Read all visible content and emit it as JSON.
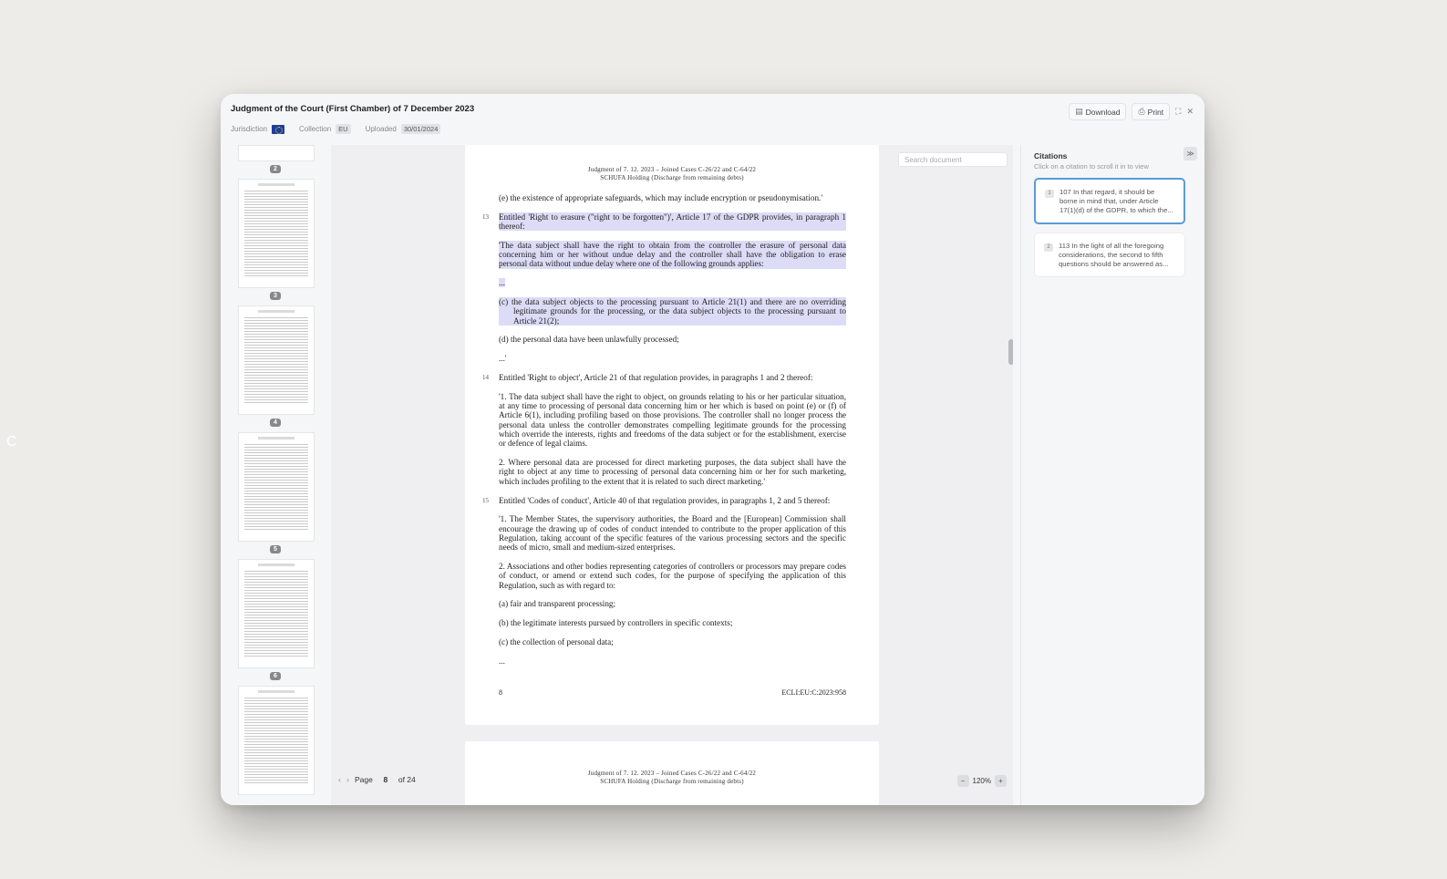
{
  "background": {
    "edge_letter": "C"
  },
  "header": {
    "title": "Judgment of the Court (First Chamber) of 7 December 2023",
    "jurisdiction_label": "Jurisdiction",
    "collection_label": "Collection",
    "collection_value": "EU",
    "uploaded_label": "Uploaded",
    "uploaded_value": "30/01/2024",
    "download_label": "Download",
    "print_label": "Print",
    "icons": {
      "download": "file-icon",
      "print": "printer-icon",
      "expand": "expand-icon",
      "close": "close-icon"
    }
  },
  "thumbnails": {
    "page_numbers": [
      "2",
      "3",
      "4",
      "5",
      "6"
    ]
  },
  "document": {
    "search_placeholder": "Search document",
    "running_head_line1": "Judgment of 7. 12. 2023 – Joined Cases C-26/22 and C-64/22",
    "running_head_line2": "SCHUFA Holding (Discharge from remaining debts)",
    "p_e_safeguards": "(e)  the existence of appropriate safeguards, which may include encryption or pseudonymisation.'",
    "p13_num": "13",
    "p13_text": "Entitled 'Right to erasure (\"right to be forgotten\")', Article 17 of the GDPR provides, in paragraph 1 thereof:",
    "p13_quote": "'The data subject shall have the right to obtain from the controller the erasure of personal data concerning him or her without undue delay and the controller shall have the obligation to erase personal data without undue delay where one of the following grounds applies:",
    "ellipsis1": "...",
    "p13_c": "(c)  the data subject objects to the processing pursuant to Article 21(1) and there are no overriding legitimate grounds for the processing, or the data subject objects to the processing pursuant to Article 21(2);",
    "p13_d": "(d)  the personal data have been unlawfully processed;",
    "ellipsis2": "...'",
    "p14_num": "14",
    "p14_text": "Entitled 'Right to object', Article 21 of that regulation provides, in paragraphs 1 and 2 thereof:",
    "p14_1": "'1.  The data subject shall have the right to object, on grounds relating to his or her particular situation, at any time to processing of personal data concerning him or her which is based on point (e) or (f) of Article 6(1), including profiling based on those provisions. The controller shall no longer process the personal data unless the controller demonstrates compelling legitimate grounds for the processing which override the interests, rights and freedoms of the data subject or for the establishment, exercise or defence of legal claims.",
    "p14_2": "2.  Where personal data are processed for direct marketing purposes, the data subject shall have the right to object at any time to processing of personal data concerning him or her for such marketing, which includes profiling to the extent that it is related to such direct marketing.'",
    "p15_num": "15",
    "p15_text": "Entitled 'Codes of conduct', Article 40 of that regulation provides, in paragraphs 1, 2 and 5 thereof:",
    "p15_1": "'1.  The Member States, the supervisory authorities, the Board and the [European] Commission shall encourage the drawing up of codes of conduct intended to contribute to the proper application of this Regulation, taking account of the specific features of the various processing sectors and the specific needs of micro, small and medium-sized enterprises.",
    "p15_2": "2.  Associations and other bodies representing categories of controllers or processors may prepare codes of conduct, or amend or extend such codes, for the purpose of specifying the application of this Regulation, such as with regard to:",
    "p15_a": "(a)  fair and transparent processing;",
    "p15_b": "(b)  the legitimate interests pursued by controllers in specific contexts;",
    "p15_c": "(c)  the collection of personal data;",
    "ellipsis3": "...",
    "footer_page": "8",
    "footer_ecli": "ECLI:EU:C:2023:958"
  },
  "pagination": {
    "page_label": "Page",
    "current_page": "8",
    "total": "of 24",
    "zoom": "120%"
  },
  "citations": {
    "title": "Citations",
    "subtitle": "Click on a citation to scroll it in to view",
    "items": [
      {
        "index": "1",
        "text": "107 In that regard, it should be borne in mind that, under Article 17(1)(d) of the GDPR, to which the..."
      },
      {
        "index": "2",
        "text": "113 In the light of all the foregoing considerations, the second to fifth questions should be answered as..."
      }
    ]
  }
}
